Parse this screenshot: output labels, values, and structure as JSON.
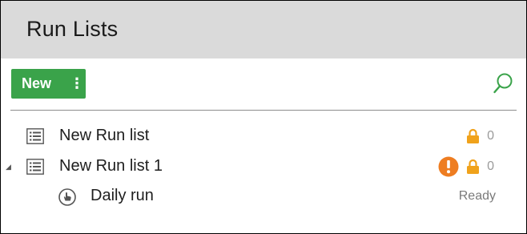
{
  "header": {
    "title": "Run Lists"
  },
  "toolbar": {
    "new_label": "New",
    "more_glyph": "⋮",
    "search_icon": "search-icon",
    "accent_color": "#3aa34a"
  },
  "tree": {
    "items": [
      {
        "name": "New Run list",
        "type": "run-list",
        "lock_count": "0",
        "locked": true,
        "warning": false,
        "expanded": null
      },
      {
        "name": "New Run list 1",
        "type": "run-list",
        "lock_count": "0",
        "locked": true,
        "warning": true,
        "expanded": true,
        "children": [
          {
            "name": "Daily run",
            "type": "run",
            "status": "Ready"
          }
        ]
      }
    ],
    "lock_color": "#f0a21b",
    "warning_color": "#ee7d21"
  }
}
